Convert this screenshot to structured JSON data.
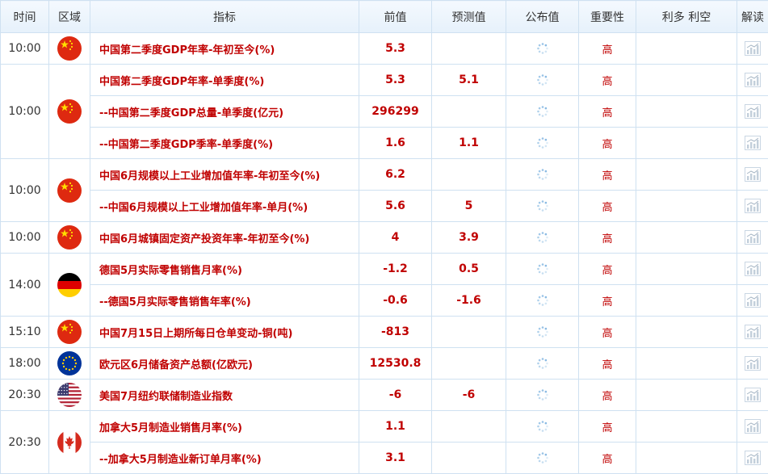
{
  "header": {
    "time": "时间",
    "region": "区域",
    "indicator": "指标",
    "previous": "前值",
    "forecast": "预测值",
    "actual": "公布值",
    "importance": "重要性",
    "impact": "利多 利空",
    "analysis": "解读"
  },
  "groups": [
    {
      "time": "10:00",
      "flag": "china-flag-icon",
      "rows": [
        {
          "indicator": "中国第二季度GDP年率-年初至今(%)",
          "previous": "5.3",
          "forecast": "",
          "importance": "高"
        }
      ]
    },
    {
      "time": "10:00",
      "flag": "china-flag-icon",
      "rows": [
        {
          "indicator": "中国第二季度GDP年率-单季度(%)",
          "previous": "5.3",
          "forecast": "5.1",
          "importance": "高"
        },
        {
          "indicator": "--中国第二季度GDP总量-单季度(亿元)",
          "previous": "296299",
          "forecast": "",
          "importance": "高"
        },
        {
          "indicator": "--中国第二季度GDP季率-单季度(%)",
          "previous": "1.6",
          "forecast": "1.1",
          "importance": "高"
        }
      ]
    },
    {
      "time": "10:00",
      "flag": "china-flag-icon",
      "rows": [
        {
          "indicator": "中国6月规模以上工业增加值年率-年初至今(%)",
          "previous": "6.2",
          "forecast": "",
          "importance": "高"
        },
        {
          "indicator": "--中国6月规模以上工业增加值年率-单月(%)",
          "previous": "5.6",
          "forecast": "5",
          "importance": "高"
        }
      ]
    },
    {
      "time": "10:00",
      "flag": "china-flag-icon",
      "rows": [
        {
          "indicator": "中国6月城镇固定资产投资年率-年初至今(%)",
          "previous": "4",
          "forecast": "3.9",
          "importance": "高"
        }
      ]
    },
    {
      "time": "14:00",
      "flag": "germany-flag-icon",
      "rows": [
        {
          "indicator": "德国5月实际零售销售月率(%)",
          "previous": "-1.2",
          "forecast": "0.5",
          "importance": "高"
        },
        {
          "indicator": "--德国5月实际零售销售年率(%)",
          "previous": "-0.6",
          "forecast": "-1.6",
          "importance": "高"
        }
      ]
    },
    {
      "time": "15:10",
      "flag": "china-flag-icon",
      "rows": [
        {
          "indicator": "中国7月15日上期所每日仓单变动-铜(吨)",
          "previous": "-813",
          "forecast": "",
          "importance": "高"
        }
      ]
    },
    {
      "time": "18:00",
      "flag": "eu-flag-icon",
      "rows": [
        {
          "indicator": "欧元区6月储备资产总额(亿欧元)",
          "previous": "12530.8",
          "forecast": "",
          "importance": "高"
        }
      ]
    },
    {
      "time": "20:30",
      "flag": "usa-flag-icon",
      "rows": [
        {
          "indicator": "美国7月纽约联储制造业指数",
          "previous": "-6",
          "forecast": "-6",
          "importance": "高"
        }
      ]
    },
    {
      "time": "20:30",
      "flag": "canada-flag-icon",
      "rows": [
        {
          "indicator": "加拿大5月制造业销售月率(%)",
          "previous": "1.1",
          "forecast": "",
          "importance": "高"
        },
        {
          "indicator": "--加拿大5月制造业新订单月率(%)",
          "previous": "3.1",
          "forecast": "",
          "importance": "高"
        }
      ]
    }
  ],
  "icons": {
    "actual": "loading-spinner-icon",
    "analysis": "chart-icon"
  },
  "colors": {
    "accent_red": "#c00000",
    "border": "#cfe1f1",
    "header_bg": "#e6f1fb"
  }
}
